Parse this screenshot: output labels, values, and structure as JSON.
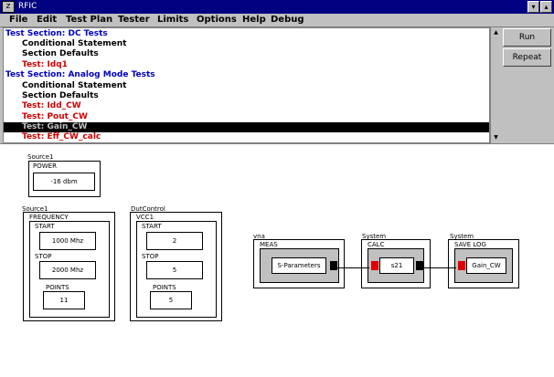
{
  "window": {
    "title": "RFIC",
    "sys_glyph": "z",
    "min_glyph": "▾",
    "max_glyph": "▴"
  },
  "menu": [
    "File",
    "Edit",
    "Test Plan",
    "Tester",
    "Limits",
    "Options",
    "Help",
    "Debug"
  ],
  "tree": [
    {
      "text": "Test Section: DC Tests",
      "style": "sec",
      "indent": 0
    },
    {
      "text": "Conditional Statement",
      "style": "blk",
      "indent": 1
    },
    {
      "text": "Section Defaults",
      "style": "blk",
      "indent": 1
    },
    {
      "text": "Test: Idq1",
      "style": "red",
      "indent": 1
    },
    {
      "text": "Test Section: Analog Mode Tests",
      "style": "sec",
      "indent": 0
    },
    {
      "text": "Conditional Statement",
      "style": "blk",
      "indent": 1
    },
    {
      "text": "Section Defaults",
      "style": "blk",
      "indent": 1
    },
    {
      "text": "Test: Idd_CW",
      "style": "red",
      "indent": 1
    },
    {
      "text": "Test: Pout_CW",
      "style": "red",
      "indent": 1
    },
    {
      "text": "Test: Gain_CW",
      "style": "sel",
      "indent": 1
    },
    {
      "text": "Test: Eff_CW_calc",
      "style": "red",
      "indent": 1
    }
  ],
  "buttons": {
    "run": "Run",
    "repeat": "Repeat"
  },
  "scroll": {
    "up": "▲",
    "down": "▼"
  },
  "diagram": {
    "power_block": {
      "owner": "Source1",
      "label": "POWER",
      "value": "-16 dbm"
    },
    "freq_block": {
      "owner": "Source1",
      "label": "FREQUENCY",
      "start_label": "START",
      "start": "1000 Mhz",
      "stop_label": "STOP",
      "stop": "2000 Mhz",
      "points_label": "POINTS",
      "points": "11"
    },
    "vcc_block": {
      "owner": "DutControl",
      "label": "VCC1",
      "start_label": "START",
      "start": "2",
      "stop_label": "STOP",
      "stop": "5",
      "points_label": "POINTS",
      "points": "5"
    },
    "meas_block": {
      "owner": "vna",
      "label": "MEAS",
      "value": "S-Parameters"
    },
    "calc_block": {
      "owner": "System",
      "label": "CALC",
      "value": "s21"
    },
    "save_block": {
      "owner": "System",
      "label": "SAVE LOG",
      "value": "Gain_CW"
    },
    "port_color": "#e00000"
  }
}
